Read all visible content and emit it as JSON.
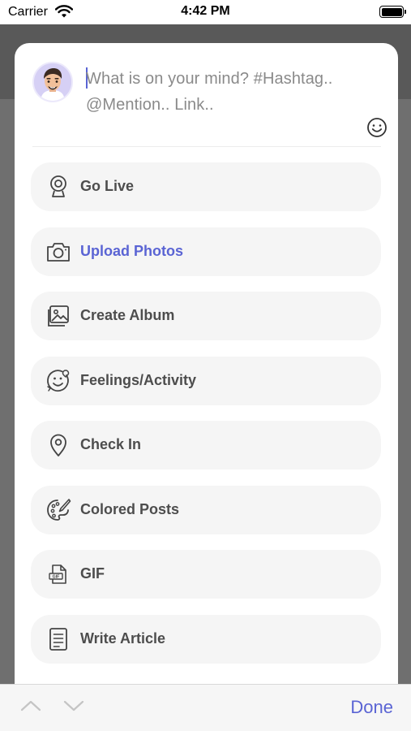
{
  "status_bar": {
    "carrier": "Carrier",
    "time": "4:42 PM"
  },
  "composer": {
    "placeholder_line1": "What is on your mind? #Hashtag..",
    "placeholder_line2": "@Mention.. Link..",
    "accent_color": "#5a64d4"
  },
  "menu": {
    "items": [
      {
        "label": "Go Live",
        "icon": "webcam-icon"
      },
      {
        "label": "Upload Photos",
        "icon": "camera-icon",
        "active": true
      },
      {
        "label": "Create Album",
        "icon": "image-gallery-icon"
      },
      {
        "label": "Feelings/Activity",
        "icon": "smiley-icon"
      },
      {
        "label": "Check In",
        "icon": "location-pin-icon"
      },
      {
        "label": "Colored Posts",
        "icon": "palette-icon"
      },
      {
        "label": "GIF",
        "icon": "gif-file-icon"
      },
      {
        "label": "Write Article",
        "icon": "document-icon"
      }
    ]
  },
  "keyboard_toolbar": {
    "done_label": "Done"
  }
}
